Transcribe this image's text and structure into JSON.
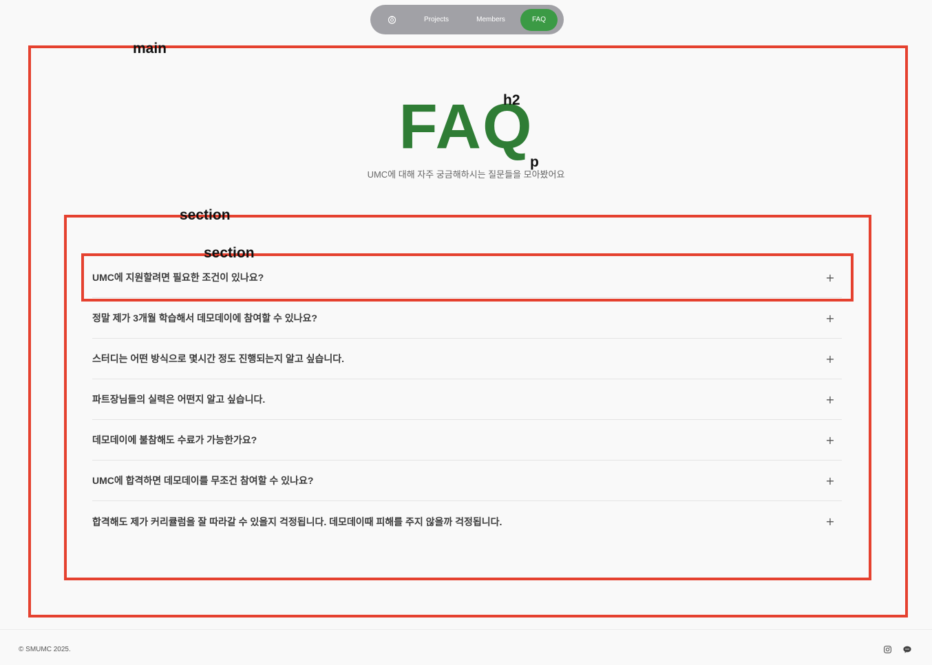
{
  "nav": {
    "logo_icon": "logo-icon",
    "items": [
      {
        "label": "Projects"
      },
      {
        "label": "Members"
      },
      {
        "label": "FAQ",
        "active": true
      }
    ],
    "active_color": "#3b9a45",
    "pill_color": "#a1a1a6"
  },
  "annotations": {
    "main_label": "main",
    "h2_label": "h2",
    "p_label": "p",
    "section_label": "section",
    "inner_section_label": "section",
    "box_color": "#e5412f"
  },
  "hero": {
    "title": "FAQ",
    "subtitle": "UMC에 대해 자주 궁금해하시는 질문들을 모아봤어요",
    "title_color": "#2f7d35"
  },
  "faq": {
    "items": [
      {
        "question": "UMC에 지원할려면 필요한 조건이 있나요?",
        "toggle_icon": "plus-icon"
      },
      {
        "question": "정말 제가 3개월 학습해서 데모데이에 참여할 수 있나요?",
        "toggle_icon": "plus-icon"
      },
      {
        "question": "스터디는 어떤 방식으로 몇시간 정도 진행되는지 알고 싶습니다.",
        "toggle_icon": "plus-icon"
      },
      {
        "question": "파트장님들의 실력은 어떤지 알고 싶습니다.",
        "toggle_icon": "plus-icon"
      },
      {
        "question": "데모데이에 불참해도 수료가 가능한가요?",
        "toggle_icon": "plus-icon"
      },
      {
        "question": "UMC에 합격하면 데모데이를 무조건 참여할 수 있나요?",
        "toggle_icon": "plus-icon"
      },
      {
        "question": "합격해도 제가 커리큘럼을 잘 따라갈 수 있을지 걱정됩니다. 데모데이때 피해를 주지 않을까 걱정됩니다.",
        "toggle_icon": "plus-icon"
      }
    ],
    "plus_symbol": "+"
  },
  "footer": {
    "copyright": "© SMUMC 2025.",
    "icons": [
      "instagram-icon",
      "kakao-chat-icon"
    ]
  }
}
